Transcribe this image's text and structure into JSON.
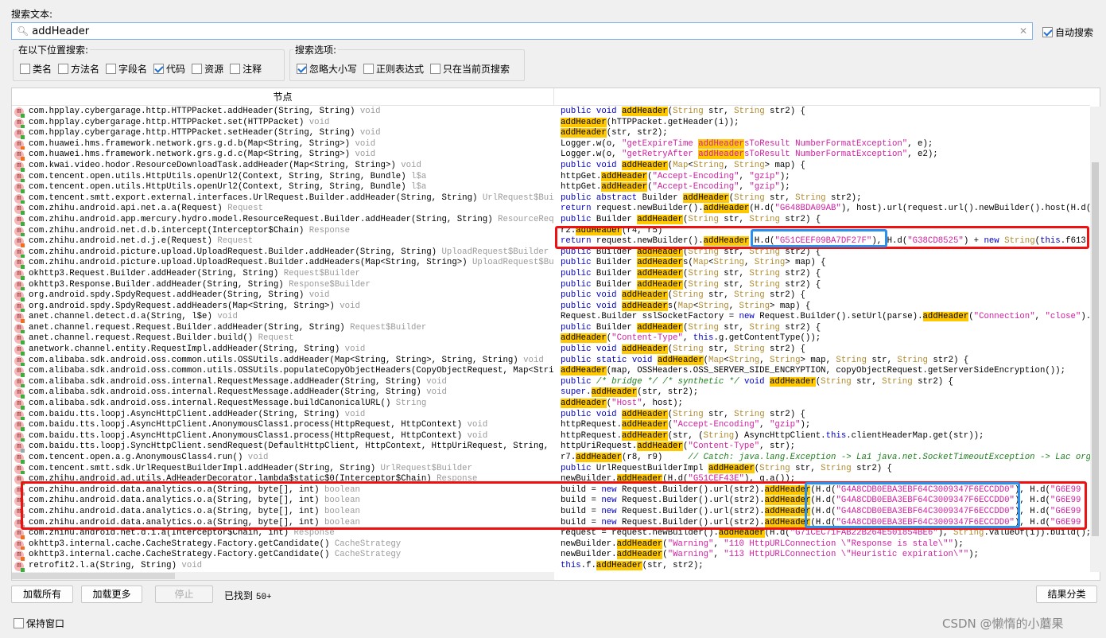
{
  "search": {
    "label": "搜索文本:",
    "value": "addHeader",
    "auto_search": "自动搜索",
    "auto_checked": true
  },
  "scope": {
    "title": "在以下位置搜索:",
    "options": [
      {
        "label": "类名",
        "checked": false
      },
      {
        "label": "方法名",
        "checked": false
      },
      {
        "label": "字段名",
        "checked": false
      },
      {
        "label": "代码",
        "checked": true
      },
      {
        "label": "资源",
        "checked": false
      },
      {
        "label": "注释",
        "checked": false
      }
    ]
  },
  "search_options": {
    "title": "搜索选项:",
    "options": [
      {
        "label": "忽略大小写",
        "checked": true
      },
      {
        "label": "正则表达式",
        "checked": false
      },
      {
        "label": "只在当前页搜索",
        "checked": false
      }
    ]
  },
  "results": {
    "column_header": "节点",
    "nodes": [
      {
        "t": "com.hpplay.cybergarage.http.HTTPPacket.addHeader(String, String)",
        "r": "void",
        "d": "green"
      },
      {
        "t": "com.hpplay.cybergarage.http.HTTPPacket.set(HTTPPacket)",
        "r": "void",
        "d": "green"
      },
      {
        "t": "com.hpplay.cybergarage.http.HTTPPacket.setHeader(String, String)",
        "r": "void",
        "d": "green"
      },
      {
        "t": "com.huawei.hms.framework.network.grs.g.d.b(Map<String, String>)",
        "r": "void",
        "d": "orange"
      },
      {
        "t": "com.huawei.hms.framework.network.grs.g.d.c(Map<String, String>)",
        "r": "void",
        "d": "orange"
      },
      {
        "t": "com.kwai.video.hodor.ResourceDownloadTask.addHeader(Map<String, String>)",
        "r": "void",
        "d": "green"
      },
      {
        "t": "com.tencent.open.utils.HttpUtils.openUrl2(Context, String, String, Bundle)",
        "r": "l$a",
        "d": "green"
      },
      {
        "t": "com.tencent.open.utils.HttpUtils.openUrl2(Context, String, String, Bundle)",
        "r": "l$a",
        "d": "green"
      },
      {
        "t": "com.tencent.smtt.export.external.interfaces.UrlRequest.Builder.addHeader(String, String)",
        "r": "UrlRequest$Builder",
        "d": "green"
      },
      {
        "t": "com.zhihu.android.api.net.a.a(Request)",
        "r": "Request",
        "d": "green"
      },
      {
        "t": "com.zhihu.android.app.mercury.hydro.model.ResourceRequest.Builder.addHeader(String, String)",
        "r": "ResourceRequest$Builder",
        "d": "green"
      },
      {
        "t": "com.zhihu.android.net.d.b.intercept(Interceptor$Chain)",
        "r": "Response",
        "d": "green"
      },
      {
        "t": "com.zhihu.android.net.d.j.e(Request)",
        "r": "Request",
        "d": "orange"
      },
      {
        "t": "com.zhihu.android.picture.upload.UploadRequest.Builder.addHeader(String, String)",
        "r": "UploadRequest$Builder",
        "d": "green"
      },
      {
        "t": "com.zhihu.android.picture.upload.UploadRequest.Builder.addHeaders(Map<String, String>)",
        "r": "UploadRequest$Builder",
        "d": "green"
      },
      {
        "t": "okhttp3.Request.Builder.addHeader(String, String)",
        "r": "Request$Builder",
        "d": "green"
      },
      {
        "t": "okhttp3.Response.Builder.addHeader(String, String)",
        "r": "Response$Builder",
        "d": "green"
      },
      {
        "t": "org.android.spdy.SpdyRequest.addHeader(String, String)",
        "r": "void",
        "d": "green"
      },
      {
        "t": "org.android.spdy.SpdyRequest.addHeaders(Map<String, String>)",
        "r": "void",
        "d": "green"
      },
      {
        "t": "anet.channel.detect.d.a(String, l$e)",
        "r": "void",
        "d": "orange"
      },
      {
        "t": "anet.channel.request.Request.Builder.addHeader(String, String)",
        "r": "Request$Builder",
        "d": "green"
      },
      {
        "t": "anet.channel.request.Request.Builder.build()",
        "r": "Request",
        "d": "green"
      },
      {
        "t": "anetwork.channel.entity.RequestImpl.addHeader(String, String)",
        "r": "void",
        "d": "green"
      },
      {
        "t": "com.alibaba.sdk.android.oss.common.utils.OSSUtils.addHeader(Map<String, String>, String, String)",
        "r": "void",
        "d": "green"
      },
      {
        "t": "com.alibaba.sdk.android.oss.common.utils.OSSUtils.populateCopyObjectHeaders(CopyObjectRequest, Map<String, String>)",
        "r": "void",
        "d": "green"
      },
      {
        "t": "com.alibaba.sdk.android.oss.internal.RequestMessage.addHeader(String, String)",
        "r": "void",
        "d": "green"
      },
      {
        "t": "com.alibaba.sdk.android.oss.internal.RequestMessage.addHeader(String, String)",
        "r": "void",
        "d": "green"
      },
      {
        "t": "com.alibaba.sdk.android.oss.internal.RequestMessage.buildCanonicalURL()",
        "r": "String",
        "d": "green"
      },
      {
        "t": "com.baidu.tts.loopj.AsyncHttpClient.addHeader(String, String)",
        "r": "void",
        "d": "green"
      },
      {
        "t": "com.baidu.tts.loopj.AsyncHttpClient.AnonymousClass1.process(HttpRequest, HttpContext)",
        "r": "void",
        "d": "green"
      },
      {
        "t": "com.baidu.tts.loopj.AsyncHttpClient.AnonymousClass1.process(HttpRequest, HttpContext)",
        "r": "void",
        "d": "green"
      },
      {
        "t": "com.baidu.tts.loopj.SyncHttpClient.sendRequest(DefaultHttpClient, HttpContext, HttpUriRequest, String, F",
        "r": "",
        "d": "grey"
      },
      {
        "t": "com.tencent.open.a.g.AnonymousClass4.run()",
        "r": "void",
        "d": "green"
      },
      {
        "t": "com.tencent.smtt.sdk.UrlRequestBuilderImpl.addHeader(String, String)",
        "r": "UrlRequest$Builder",
        "d": "green"
      },
      {
        "t": "com.zhihu.android.ad.utils.AdHeaderDecorator.lambda$static$0(Interceptor$Chain)",
        "r": "Response",
        "d": "green"
      },
      {
        "t": "com.zhihu.android.data.analytics.o.a(String, byte[], int)",
        "r": "boolean",
        "d": "grey"
      },
      {
        "t": "com.zhihu.android.data.analytics.o.a(String, byte[], int)",
        "r": "boolean",
        "d": "grey"
      },
      {
        "t": "com.zhihu.android.data.analytics.o.a(String, byte[], int)",
        "r": "boolean",
        "d": "grey"
      },
      {
        "t": "com.zhihu.android.data.analytics.o.a(String, byte[], int)",
        "r": "boolean",
        "d": "grey"
      },
      {
        "t": "com.zhihu.android.net.d.i.a(Interceptor$Chain, int)",
        "r": "Response",
        "d": "orange"
      },
      {
        "t": "okhttp3.internal.cache.CacheStrategy.Factory.getCandidate()",
        "r": "CacheStrategy",
        "d": "orange"
      },
      {
        "t": "okhttp3.internal.cache.CacheStrategy.Factory.getCandidate()",
        "r": "CacheStrategy",
        "d": "orange"
      },
      {
        "t": "retrofit2.l.a(String, String)",
        "r": "void",
        "d": "green"
      }
    ],
    "code": [
      "public void addHeader(String str, String str2) {",
      "addHeader(hTTPPacket.getHeader(i));",
      "addHeader(str, str2);",
      "Logger.w(o, \"getExpireTime addHeadersToResult NumberFormatException\", e);",
      "Logger.w(o, \"getRetryAfter addHeadersToResult NumberFormatException\", e2);",
      "public void addHeader(Map<String, String> map) {",
      "httpGet.addHeader(\"Accept-Encoding\", \"gzip\");",
      "httpGet.addHeader(\"Accept-Encoding\", \"gzip\");",
      "public abstract Builder addHeader(String str, String str2);",
      "return request.newBuilder().addHeader(H.d(\"G648BDA09AB\"), host).url(request.url().newBuilder().host(H.d(",
      "public Builder addHeader(String str, String str2) {",
      "r2.addHeader(r4, r5)",
      "return request.newBuilder().addHeader(H.d(\"G51CEEF09BA7DF27F\"), H.d(\"G38CD8525\") + new String(this.f613",
      "public Builder addHeader(String str, String str2) {",
      "public Builder addHeaders(Map<String, String> map) {",
      "public Builder addHeader(String str, String str2) {",
      "public Builder addHeader(String str, String str2) {",
      "public void addHeader(String str, String str2) {",
      "public void addHeaders(Map<String, String> map) {",
      "Request.Builder sslSocketFactory = new Request.Builder().setUrl(parse).addHeader(\"Connection\", \"close\").",
      "public Builder addHeader(String str, String str2) {",
      "addHeader(\"Content-Type\", this.g.getContentType());",
      "public void addHeader(String str, String str2) {",
      "public static void addHeader(Map<String, String> map, String str, String str2) {",
      "addHeader(map, OSSHeaders.OSS_SERVER_SIDE_ENCRYPTION, copyObjectRequest.getServerSideEncryption());",
      "public /* bridge */ /* synthetic */ void addHeader(String str, String str2) {",
      "super.addHeader(str, str2);",
      "addHeader(\"Host\", host);",
      "public void addHeader(String str, String str2) {",
      "httpRequest.addHeader(\"Accept-Encoding\", \"gzip\");",
      "httpRequest.addHeader(str, (String) AsyncHttpClient.this.clientHeaderMap.get(str));",
      "httpUriRequest.addHeader(\"Content-Type\", str);",
      "r7.addHeader(r8, r9)     // Catch: java.lang.Exception -> La1 java.net.SocketTimeoutException -> Lac org",
      "public UrlRequestBuilderImpl addHeader(String str, String str2) {",
      "newBuilder.addHeader(H.d(\"G51CEF43E\"), g.a());",
      "build = new Request.Builder().url(str2).addHeader(H.d(\"G4A8CDB0EBA3EBF64C3009347F6ECCDD0\"), H.d(\"G6E99",
      "build = new Request.Builder().url(str2).addHeader(H.d(\"G4A8CDB0EBA3EBF64C3009347F6ECCDD0\"), H.d(\"G6E99",
      "build = new Request.Builder().url(str2).addHeader(H.d(\"G4A8CDB0EBA3EBF64C3009347F6ECCDD0\"), H.d(\"G6E99",
      "build = new Request.Builder().url(str2).addHeader(H.d(\"G4A8CDB0EBA3EBF64C3009347F6ECCDD0\"), H.d(\"G6E99",
      "request = request.newBuilder().addHeader(H.d(\"G71CEC71FAB22B264E501854BE6\"), String.valueOf(i)).build();",
      "newBuilder.addHeader(\"Warning\", \"110 HttpURLConnection \\\"Response is stale\\\"\");",
      "newBuilder.addHeader(\"Warning\", \"113 HttpURLConnection \\\"Heuristic expiration\\\"\");",
      "this.f.addHeader(str, str2);"
    ]
  },
  "footer": {
    "load_all": "加载所有",
    "load_more": "加载更多",
    "stop": "停止",
    "found_label": "已找到",
    "found_count": "50+",
    "group_results": "结果分类",
    "keep_window": "保持窗口",
    "keep_checked": false
  },
  "watermark": "CSDN @懒惰的小蘑果",
  "colors": {
    "highlight": "#ffc800",
    "annotation_red": "#f01010",
    "annotation_blue": "#2a90f0",
    "keyword": "#0000c8",
    "string": "#d020a0"
  }
}
